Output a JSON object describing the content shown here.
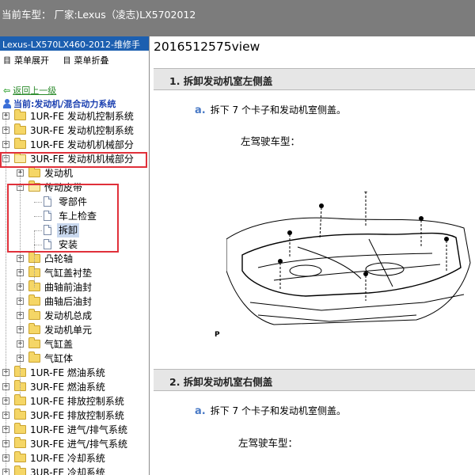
{
  "topbar": {
    "current_vehicle": "当前车型：  厂家:Lexus（凌志)LX5702012"
  },
  "sidebar": {
    "manual_title": "Lexus-LX570LX460-2012-维修手",
    "expand_label": "菜单展开",
    "collapse_label": "菜单折叠",
    "back_label": "返回上一级",
    "current_path": "当前:发动机/混合动力系统",
    "tree": [
      {
        "label": "1UR-FE 发动机控制系统",
        "toggle": "+"
      },
      {
        "label": "3UR-FE 发动机控制系统",
        "toggle": "+"
      },
      {
        "label": "1UR-FE 发动机机械部分",
        "toggle": "+"
      },
      {
        "label": "3UR-FE 发动机机械部分",
        "toggle": "−"
      },
      {
        "label": "发动机",
        "toggle": "+"
      },
      {
        "label": "传动皮带",
        "toggle": "−"
      },
      {
        "label": "零部件"
      },
      {
        "label": "车上检查"
      },
      {
        "label": "拆卸",
        "selected": true
      },
      {
        "label": "安装"
      },
      {
        "label": "凸轮轴",
        "toggle": "+"
      },
      {
        "label": "气缸盖衬垫",
        "toggle": "+"
      },
      {
        "label": "曲轴前油封",
        "toggle": "+"
      },
      {
        "label": "曲轴后油封",
        "toggle": "+"
      },
      {
        "label": "发动机总成",
        "toggle": "+"
      },
      {
        "label": "发动机单元",
        "toggle": "+"
      },
      {
        "label": "气缸盖",
        "toggle": "+"
      },
      {
        "label": "气缸体",
        "toggle": "+"
      },
      {
        "label": "1UR-FE 燃油系统",
        "toggle": "+"
      },
      {
        "label": "3UR-FE 燃油系统",
        "toggle": "+"
      },
      {
        "label": "1UR-FE 排放控制系统",
        "toggle": "+"
      },
      {
        "label": "3UR-FE 排放控制系统",
        "toggle": "+"
      },
      {
        "label": "1UR-FE 进气/排气系统",
        "toggle": "+"
      },
      {
        "label": "3UR-FE 进气/排气系统",
        "toggle": "+"
      },
      {
        "label": "1UR-FE 冷却系统",
        "toggle": "+"
      },
      {
        "label": "3UR-FE 冷却系统",
        "toggle": "+"
      }
    ]
  },
  "content": {
    "doc_id": "2016512575view",
    "steps": [
      {
        "title": "1. 拆卸发动机室左侧盖",
        "letter": "a.",
        "text": "拆下 7 个卡子和发动机室侧盖。",
        "note": "左驾驶车型："
      },
      {
        "title": "2. 拆卸发动机室右侧盖",
        "letter": "a.",
        "text": "拆下 7 个卡子和发动机室侧盖。",
        "note": "左驾驶车型："
      }
    ],
    "figure_label": "P"
  },
  "colors": {
    "topbar_bg": "#7c7c7c",
    "title_bar_bg": "#1c5fb0",
    "highlight_box": "#e0303a",
    "selected_bg": "#c9d8ee",
    "step_header_bg": "#e6e6e6",
    "substep_letter": "#4a7ac6"
  },
  "icons": {
    "back": "green-back-arrow-icon",
    "current": "person-location-icon",
    "folder": "folder-icon",
    "document": "document-icon",
    "toggle": "expand-collapse-box-icon"
  }
}
